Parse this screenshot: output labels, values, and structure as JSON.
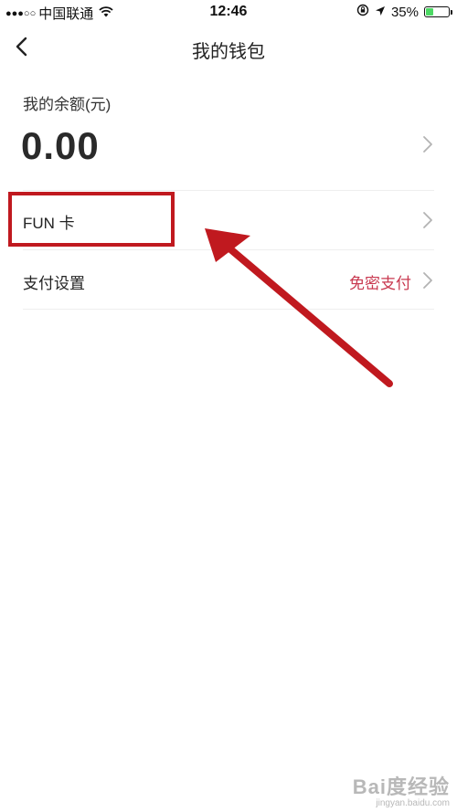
{
  "status_bar": {
    "signal": "●●●○○",
    "carrier": "中国联通",
    "time": "12:46",
    "battery": "35%",
    "battery_level": 0.35
  },
  "nav": {
    "title": "我的钱包"
  },
  "balance": {
    "label": "我的余额(元)",
    "value": "0.00"
  },
  "rows": [
    {
      "label": "FUN 卡",
      "value": ""
    },
    {
      "label": "支付设置",
      "value": "免密支付"
    }
  ],
  "colors": {
    "accent": "#c8384f",
    "highlight": "#c0191f",
    "battery": "#4cd964"
  },
  "watermark": {
    "main": "Bai度经验",
    "url": "jingyan.baidu.com"
  }
}
